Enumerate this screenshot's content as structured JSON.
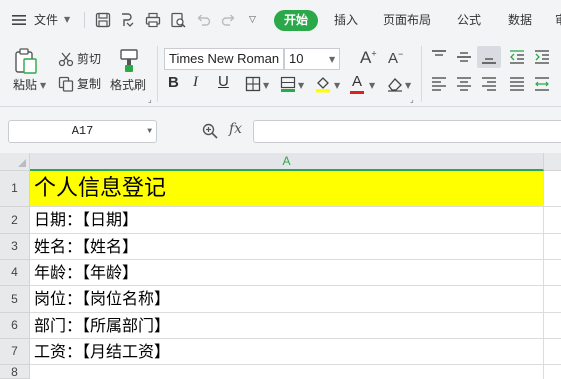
{
  "menubar": {
    "file_label": "文件",
    "active_tab": "开始",
    "tabs": [
      "插入",
      "页面布局",
      "公式",
      "数据",
      "审"
    ]
  },
  "ribbon": {
    "paste_label": "粘贴",
    "cut_label": "剪切",
    "copy_label": "复制",
    "format_painter_label": "格式刷",
    "font_name": "Times New Roman",
    "font_size": "10",
    "font_color": "#e02020",
    "fill_color": "#ffff00"
  },
  "formula_bar": {
    "name_box": "A17",
    "fx_label": "fx",
    "formula_value": ""
  },
  "sheet": {
    "column_header": "A",
    "title_fill": "#ffff00",
    "accent": "#2ba84a",
    "rows": [
      {
        "num": "1",
        "text": "个人信息登记"
      },
      {
        "num": "2",
        "text": "日期：【日期】"
      },
      {
        "num": "3",
        "text": "姓名：【姓名】"
      },
      {
        "num": "4",
        "text": "年龄：【年龄】"
      },
      {
        "num": "5",
        "text": "岗位：【岗位名称】"
      },
      {
        "num": "6",
        "text": "部门：【所属部门】"
      },
      {
        "num": "7",
        "text": "工资：【月结工资】"
      },
      {
        "num": "8",
        "text": ""
      }
    ]
  }
}
